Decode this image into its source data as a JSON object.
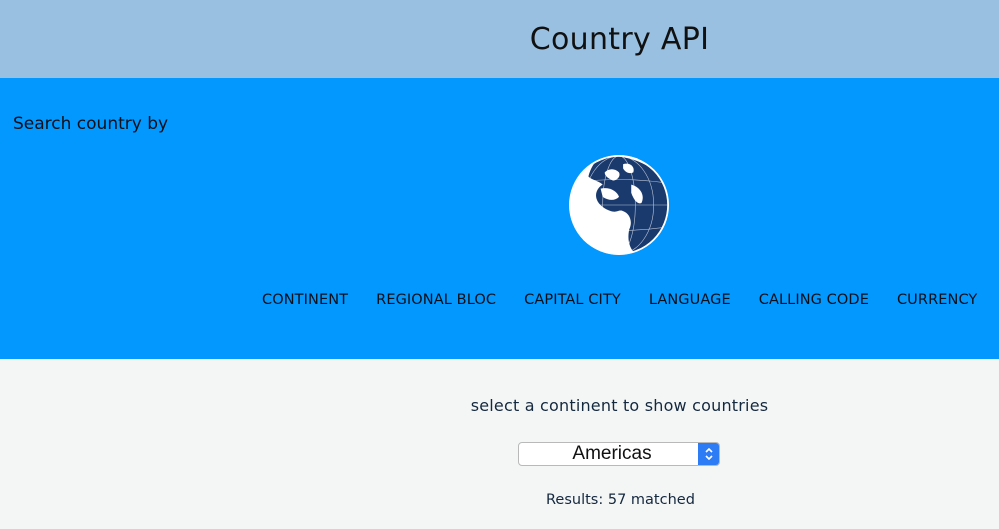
{
  "header": {
    "title": "Country API"
  },
  "hero": {
    "search_label": "Search country by",
    "nav": [
      {
        "label": "CONTINENT"
      },
      {
        "label": "REGIONAL BLOC"
      },
      {
        "label": "CAPITAL CITY"
      },
      {
        "label": "LANGUAGE"
      },
      {
        "label": "CALLING CODE"
      },
      {
        "label": "CURRENCY"
      }
    ]
  },
  "main": {
    "prompt": "select a continent to show countries",
    "select": {
      "value": "Americas"
    },
    "results": "Results: 57 matched"
  },
  "icons": {
    "globe": "globe-icon",
    "select_arrows": "chevron-updown-icon"
  },
  "colors": {
    "topbar": "#99c0e1",
    "hero": "#0298fd",
    "globe_ocean": "#1a3a6e"
  }
}
